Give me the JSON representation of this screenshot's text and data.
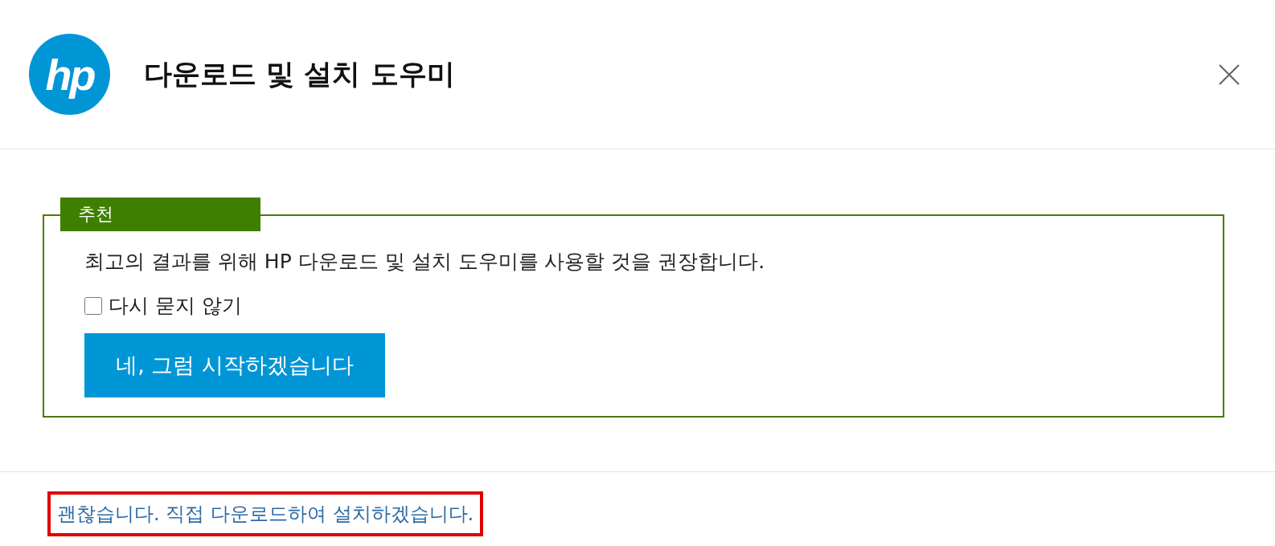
{
  "header": {
    "logo": "hp",
    "title": "다운로드 및 설치 도우미"
  },
  "recommendation": {
    "tag": "추천",
    "message": "최고의 결과를 위해 HP 다운로드 및 설치 도우미를 사용할 것을 권장합니다.",
    "dont_ask": {
      "label": "다시 묻지 않기",
      "checked": false
    },
    "button": "네, 그럼 시작하겠습니다"
  },
  "footer": {
    "link": "괜찮습니다. 직접 다운로드하여 설치하겠습니다.",
    "highlighted": true
  }
}
